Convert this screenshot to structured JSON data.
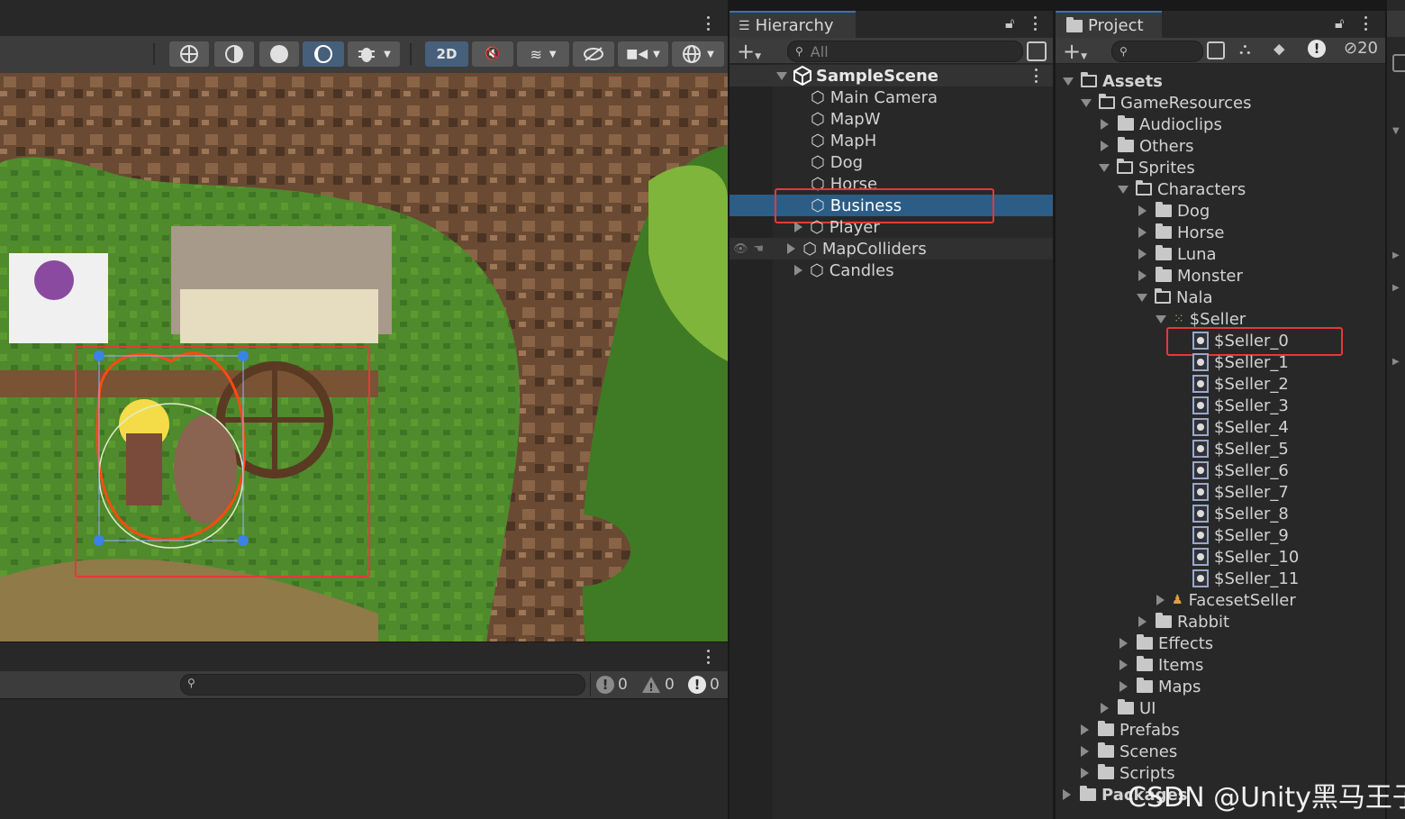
{
  "scene_toolbar": {
    "twod_label": "2D"
  },
  "console": {
    "counts": {
      "info": "0",
      "warning": "0",
      "error": "0"
    }
  },
  "hierarchy": {
    "tab_title": "Hierarchy",
    "search_placeholder": "All",
    "scene": "SampleScene",
    "items": [
      "Main Camera",
      "MapW",
      "MapH",
      "Dog",
      "Horse",
      "Business",
      "Player",
      "MapColliders",
      "Candles"
    ],
    "selected": "Business"
  },
  "project": {
    "tab_title": "Project",
    "badge_count": "20",
    "tree": {
      "assets": "Assets",
      "game_resources": "GameResources",
      "audioclips": "Audioclips",
      "others": "Others",
      "sprites": "Sprites",
      "characters": "Characters",
      "dog": "Dog",
      "horse": "Horse",
      "luna": "Luna",
      "monster": "Monster",
      "nala": "Nala",
      "seller": "$Seller",
      "seller_children": [
        "$Seller_0",
        "$Seller_1",
        "$Seller_2",
        "$Seller_3",
        "$Seller_4",
        "$Seller_5",
        "$Seller_6",
        "$Seller_7",
        "$Seller_8",
        "$Seller_9",
        "$Seller_10",
        "$Seller_11"
      ],
      "faceset_seller": "FacesetSeller",
      "rabbit": "Rabbit",
      "effects": "Effects",
      "items": "Items",
      "maps": "Maps",
      "ui": "UI",
      "prefabs": "Prefabs",
      "scenes": "Scenes",
      "scripts": "Scripts",
      "packages": "Packages"
    }
  },
  "watermark": "CSDN @Unity黑马王子",
  "colors": {
    "selection": "#2c5d87",
    "highlight_box": "#e23a3a",
    "accent": "#3a72b0"
  }
}
